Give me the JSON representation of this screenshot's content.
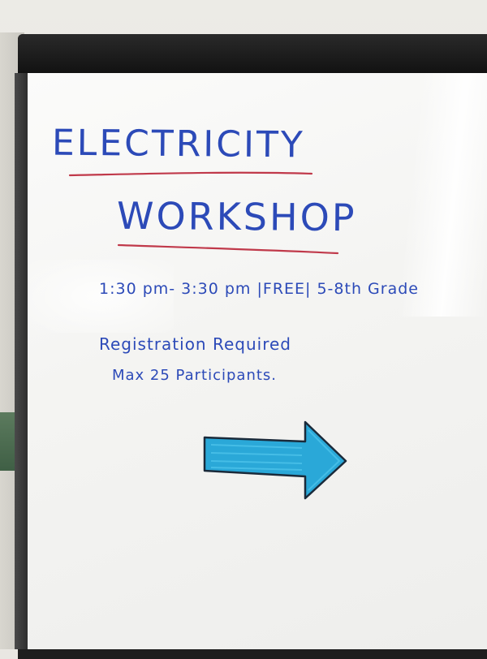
{
  "whiteboard": {
    "title_line1": "ELECTRICITY",
    "title_line2": "WORKSHOP",
    "schedule": "1:30 pm- 3:30 pm |FREE| 5-8th Grade",
    "registration": "Registration Required",
    "capacity": "Max 25 Participants."
  },
  "colors": {
    "marker_blue": "#2c4ab8",
    "underline_red": "#c0394a",
    "arrow_fill": "#2aa8d8"
  },
  "icons": {
    "arrow": "arrow-right-icon"
  }
}
